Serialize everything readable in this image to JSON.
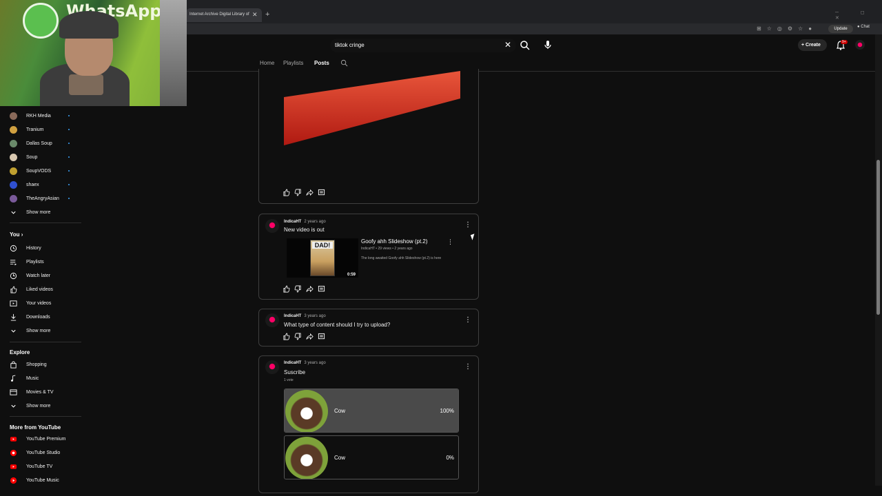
{
  "browser": {
    "tab_title": "Internet Archive Digital Library of",
    "close_glyph": "✕",
    "new_tab_glyph": "+",
    "update_label": "Update",
    "chat_label": "Chat"
  },
  "webcam": {
    "sign_text": "WhatsApp"
  },
  "header": {
    "search_value": "tiktok cringe",
    "create_label": "Create",
    "notification_count": "9+"
  },
  "channel_tabs": [
    "Home",
    "Playlists",
    "Posts"
  ],
  "sidebar": {
    "subscriptions": [
      {
        "label": "RKH Media",
        "color": "#8a6a5a"
      },
      {
        "label": "Tranium",
        "color": "#d0a040"
      },
      {
        "label": "Dallas Soup",
        "color": "#6a8a6a"
      },
      {
        "label": "Soup",
        "color": "#d8c8b0"
      },
      {
        "label": "SoupVODS",
        "color": "#c0a030"
      },
      {
        "label": "shaex",
        "color": "#3050d0"
      },
      {
        "label": "TheAngryAsian",
        "color": "#7a5a9a"
      }
    ],
    "show_more_1": "Show more",
    "you_heading": "You",
    "you_items": [
      {
        "label": "History",
        "icon": "history-icon"
      },
      {
        "label": "Playlists",
        "icon": "playlists-icon"
      },
      {
        "label": "Watch later",
        "icon": "clock-icon"
      },
      {
        "label": "Liked videos",
        "icon": "thumbs-up-icon"
      },
      {
        "label": "Your videos",
        "icon": "video-icon"
      },
      {
        "label": "Downloads",
        "icon": "download-icon"
      }
    ],
    "show_more_2": "Show more",
    "explore_heading": "Explore",
    "explore_items": [
      {
        "label": "Shopping",
        "icon": "bag-icon"
      },
      {
        "label": "Music",
        "icon": "music-icon"
      },
      {
        "label": "Movies & TV",
        "icon": "film-icon"
      }
    ],
    "show_more_3": "Show more",
    "more_heading": "More from YouTube",
    "more_items": [
      {
        "label": "YouTube Premium"
      },
      {
        "label": "YouTube Studio"
      },
      {
        "label": "YouTube TV"
      },
      {
        "label": "YouTube Music"
      }
    ]
  },
  "posts": [
    {
      "author": "IndicaHT",
      "time": "2 years ago",
      "text": "New video is out",
      "video": {
        "title": "Goofy ahh Slideshow (pt.2)",
        "meta": "IndicaHT • 29 views • 2 years ago",
        "description": "The long awaited Goofy ahh Slideshow (pt.2) is here",
        "duration": "0:59",
        "thumb_text": "DAD!"
      }
    },
    {
      "author": "IndicaHT",
      "time": "3 years ago",
      "text": "What type of content should I try to upload?"
    },
    {
      "author": "IndicaHT",
      "time": "3 years ago",
      "text": "Suscribe",
      "votes": "1 vote",
      "poll": [
        {
          "label": "Cow",
          "percent": "100%",
          "fraction": 1.0
        },
        {
          "label": "Cow",
          "percent": "0%",
          "fraction": 0.0
        }
      ]
    }
  ],
  "colors": {
    "background": "#0f0f0f",
    "accent_red": "#cc0000",
    "subscription_dot": "#3ea6ff"
  }
}
